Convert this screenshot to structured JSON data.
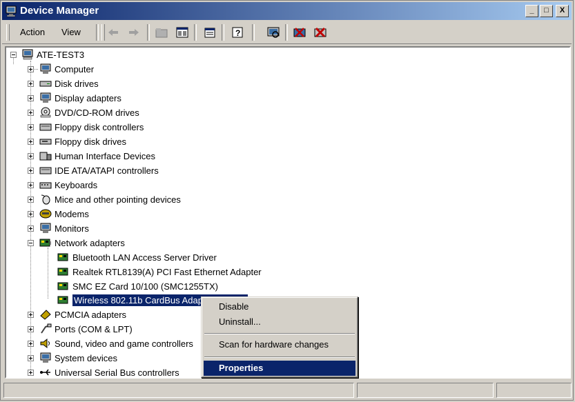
{
  "window": {
    "title": "Device Manager"
  },
  "title_buttons": {
    "minimize": "_",
    "maximize": "□",
    "close": "X"
  },
  "menu": {
    "action": "Action",
    "view": "View"
  },
  "toolbar_icons": [
    "back-arrow-icon",
    "forward-arrow-icon",
    "up-folder-icon",
    "show-hide-tree-icon",
    "properties-icon",
    "help-icon",
    "scan-hardware-icon",
    "uninstall-icon",
    "disable-icon"
  ],
  "tree": {
    "root": "ATE-TEST3",
    "categories": [
      "Computer",
      "Disk drives",
      "Display adapters",
      "DVD/CD-ROM drives",
      "Floppy disk controllers",
      "Floppy disk drives",
      "Human Interface Devices",
      "IDE ATA/ATAPI controllers",
      "Keyboards",
      "Mice and other pointing devices",
      "Modems",
      "Monitors",
      "Network adapters",
      "PCMCIA adapters",
      "Ports (COM & LPT)",
      "Sound, video and game controllers",
      "System devices",
      "Universal Serial Bus controllers"
    ],
    "network_children": [
      "Bluetooth LAN Access Server Driver",
      "Realtek RTL8139(A) PCI Fast Ethernet Adapter",
      "SMC EZ Card 10/100 (SMC1255TX)",
      "Wireless 802.11b CardBus Adapter (PABG)"
    ]
  },
  "context_menu": {
    "disable": "Disable",
    "uninstall": "Uninstall...",
    "scan": "Scan for hardware changes",
    "properties": "Properties"
  },
  "colors": {
    "selection": "#0a246a",
    "titlebar_start": "#0a246a",
    "titlebar_end": "#a6caf0",
    "face": "#d4d0c8"
  }
}
